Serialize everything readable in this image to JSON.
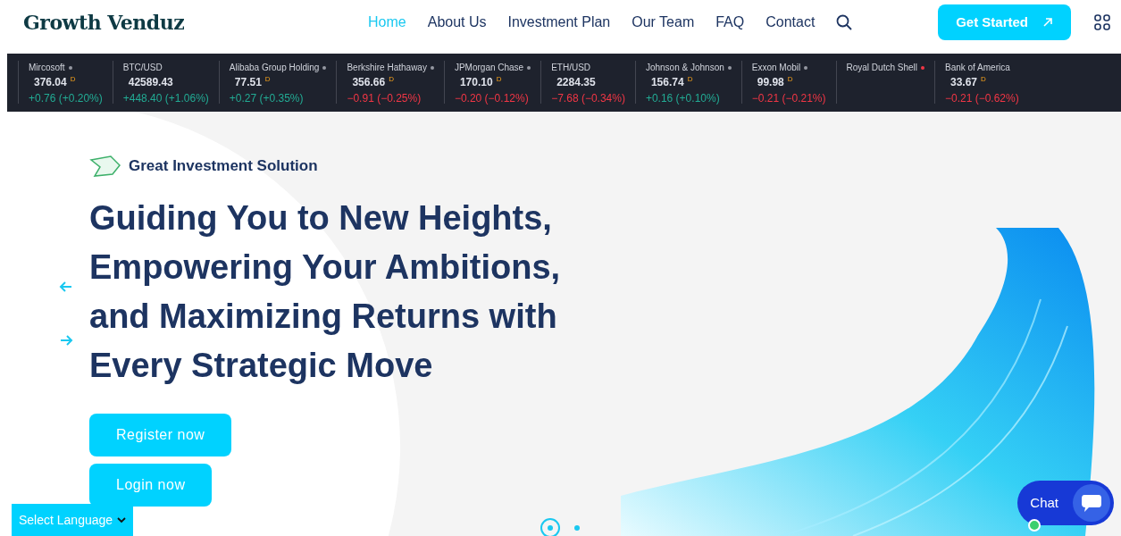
{
  "header": {
    "logo": "Growth Venduz",
    "nav": [
      {
        "label": "Home",
        "selected": true
      },
      {
        "label": "About Us",
        "selected": false
      },
      {
        "label": "Investment Plan",
        "selected": false
      },
      {
        "label": "Our Team",
        "selected": false
      },
      {
        "label": "FAQ",
        "selected": false
      },
      {
        "label": "Contact",
        "selected": false
      }
    ],
    "cta": "Get Started"
  },
  "ticker": [
    {
      "name": "Mircosoft",
      "dot": {
        "color": "#9598a1"
      },
      "price": "376.04",
      "delay_mark": "D",
      "change": {
        "text": "+0.76 (+0.20%)",
        "color": "#22ab94"
      }
    },
    {
      "name": "BTC/USD",
      "price": "42589.43",
      "change": {
        "text": "+448.40 (+1.06%)",
        "color": "#22ab94"
      }
    },
    {
      "name": "Alibaba Group Holding",
      "dot": {
        "color": "#9598a1"
      },
      "price": "77.51",
      "delay_mark": "D",
      "change": {
        "text": "+0.27 (+0.35%)",
        "color": "#22ab94"
      }
    },
    {
      "name": "Berkshire Hathaway",
      "dot": {
        "color": "#9598a1"
      },
      "price": "356.66",
      "delay_mark": "D",
      "change": {
        "text": "−0.91 (−0.25%)",
        "color": "#f23645"
      }
    },
    {
      "name": "JPMorgan Chase",
      "dot": {
        "color": "#9598a1"
      },
      "price": "170.10",
      "delay_mark": "D",
      "change": {
        "text": "−0.20 (−0.12%)",
        "color": "#f23645"
      }
    },
    {
      "name": "ETH/USD",
      "price": "2284.35",
      "change": {
        "text": "−7.68 (−0.34%)",
        "color": "#f23645"
      }
    },
    {
      "name": "Johnson & Johnson",
      "dot": {
        "color": "#9598a1"
      },
      "price": "156.74",
      "delay_mark": "D",
      "change": {
        "text": "+0.16 (+0.10%)",
        "color": "#22ab94"
      }
    },
    {
      "name": "Exxon Mobil",
      "dot": {
        "color": "#9598a1"
      },
      "price": "99.98",
      "delay_mark": "D",
      "change": {
        "text": "−0.21 (−0.21%)",
        "color": "#f23645"
      }
    },
    {
      "name": "Royal Dutch Shell",
      "dot": {
        "color": "#f23645"
      }
    },
    {
      "name": "Bank of America",
      "price": "33.67",
      "delay_mark": "D",
      "change": {
        "text": "−0.21 (−0.62%)",
        "color": "#f23645"
      }
    }
  ],
  "hero": {
    "tagline": "Great Investment Solution",
    "headline": "Guiding You to New Heights, Empowering Your Ambitions, and Maximizing Returns with Every Strategic Move",
    "buttons": [
      "Register now",
      "Login now"
    ],
    "slides": [
      {
        "selected": true
      },
      {
        "selected": false
      }
    ]
  },
  "language_select": "Select Language",
  "chat": "Chat"
}
